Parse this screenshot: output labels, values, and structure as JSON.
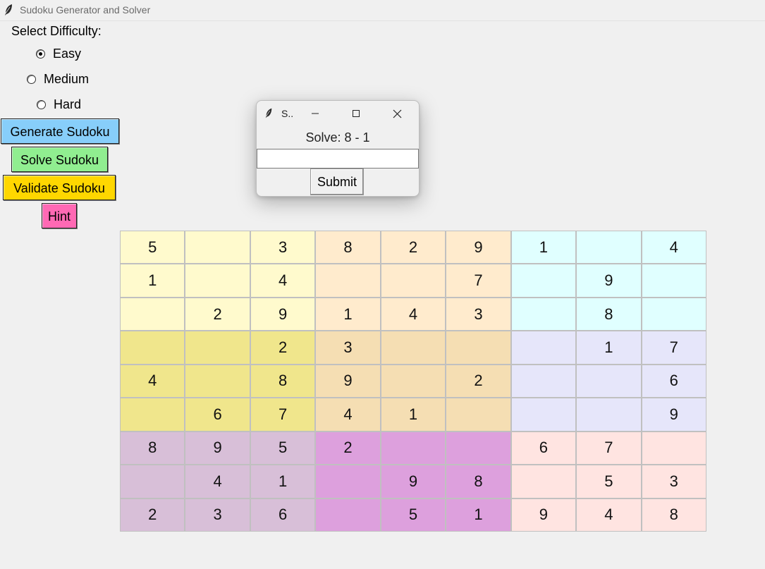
{
  "window": {
    "title": "Sudoku Generator and Solver",
    "icon": "feather-icon"
  },
  "controls": {
    "difficulty_label": "Select Difficulty:",
    "difficulty_options": [
      {
        "label": "Easy",
        "checked": true
      },
      {
        "label": "Medium",
        "checked": false
      },
      {
        "label": "Hard",
        "checked": false
      }
    ],
    "buttons": {
      "generate": "Generate Sudoku",
      "solve": "Solve Sudoku",
      "validate": "Validate Sudoku",
      "hint": "Hint"
    },
    "button_colors": {
      "generate": "#87cefa",
      "solve": "#90ee90",
      "validate": "#ffd700",
      "hint": "#ff69b4"
    }
  },
  "grid": {
    "rows": [
      [
        "5",
        "",
        "3",
        "8",
        "2",
        "9",
        "1",
        "",
        "4"
      ],
      [
        "1",
        "",
        "4",
        "",
        "",
        "7",
        "",
        "9",
        ""
      ],
      [
        "",
        "2",
        "9",
        "1",
        "4",
        "3",
        "",
        "8",
        ""
      ],
      [
        "",
        "",
        "2",
        "3",
        "",
        "",
        "",
        "1",
        "7"
      ],
      [
        "4",
        "",
        "8",
        "9",
        "",
        "2",
        "",
        "",
        "6"
      ],
      [
        "",
        "6",
        "7",
        "4",
        "1",
        "",
        "",
        "",
        "9"
      ],
      [
        "8",
        "9",
        "5",
        "2",
        "",
        "",
        "6",
        "7",
        ""
      ],
      [
        "",
        "4",
        "1",
        "",
        "9",
        "8",
        "",
        "5",
        "3"
      ],
      [
        "2",
        "3",
        "6",
        "",
        "5",
        "1",
        "9",
        "4",
        "8"
      ]
    ],
    "box_colors": [
      [
        "#fffacd",
        "#ffebcd",
        "#e0ffff"
      ],
      [
        "#f0e68c",
        "#f5deb3",
        "#e6e6fa"
      ],
      [
        "#d8bfd8",
        "#dda0dd",
        "#ffe4e1"
      ]
    ]
  },
  "dialog": {
    "title": "S..",
    "prompt": "Solve: 8 - 1",
    "input_value": "",
    "submit_label": "Submit"
  }
}
